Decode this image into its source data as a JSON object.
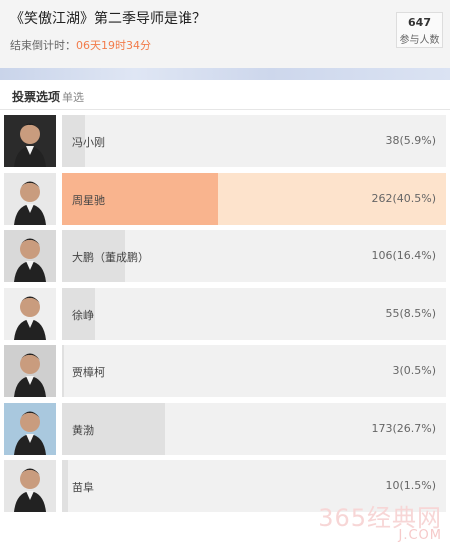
{
  "header": {
    "title": "《笑傲江湖》第二季导师是谁？",
    "countdown_label": "结束倒计时：",
    "countdown_value": "06天19时34分",
    "participants_count": "647",
    "participants_label": "参与人数"
  },
  "options_bar": {
    "title": "投票选项",
    "mode": "单选"
  },
  "options": [
    {
      "name": "冯小刚",
      "value_text": "38(5.9%)",
      "percent": 5.9,
      "selected": false,
      "avatar_bg": "#2b2b2b"
    },
    {
      "name": "周星驰",
      "value_text": "262(40.5%)",
      "percent": 40.5,
      "selected": true,
      "avatar_bg": "#e8e8e8"
    },
    {
      "name": "大鹏（董成鹏）",
      "value_text": "106(16.4%)",
      "percent": 16.4,
      "selected": false,
      "avatar_bg": "#d9d9d9"
    },
    {
      "name": "徐峥",
      "value_text": "55(8.5%)",
      "percent": 8.5,
      "selected": false,
      "avatar_bg": "#efefef"
    },
    {
      "name": "贾樟柯",
      "value_text": "3(0.5%)",
      "percent": 0.5,
      "selected": false,
      "avatar_bg": "#cfcfcf"
    },
    {
      "name": "黄渤",
      "value_text": "173(26.7%)",
      "percent": 26.7,
      "selected": false,
      "avatar_bg": "#a9c8de"
    },
    {
      "name": "苗阜",
      "value_text": "10(1.5%)",
      "percent": 1.5,
      "selected": false,
      "avatar_bg": "#e6e6e6"
    }
  ],
  "watermark": {
    "text": "365经典网",
    "url": "J.COM"
  },
  "colors": {
    "countdown_accent": "#f27b4a",
    "selected_fill": "#f9b48e",
    "selected_track": "#fde3cc",
    "bar_fill": "#e0e0e0",
    "bar_track": "#f1f1f1"
  }
}
